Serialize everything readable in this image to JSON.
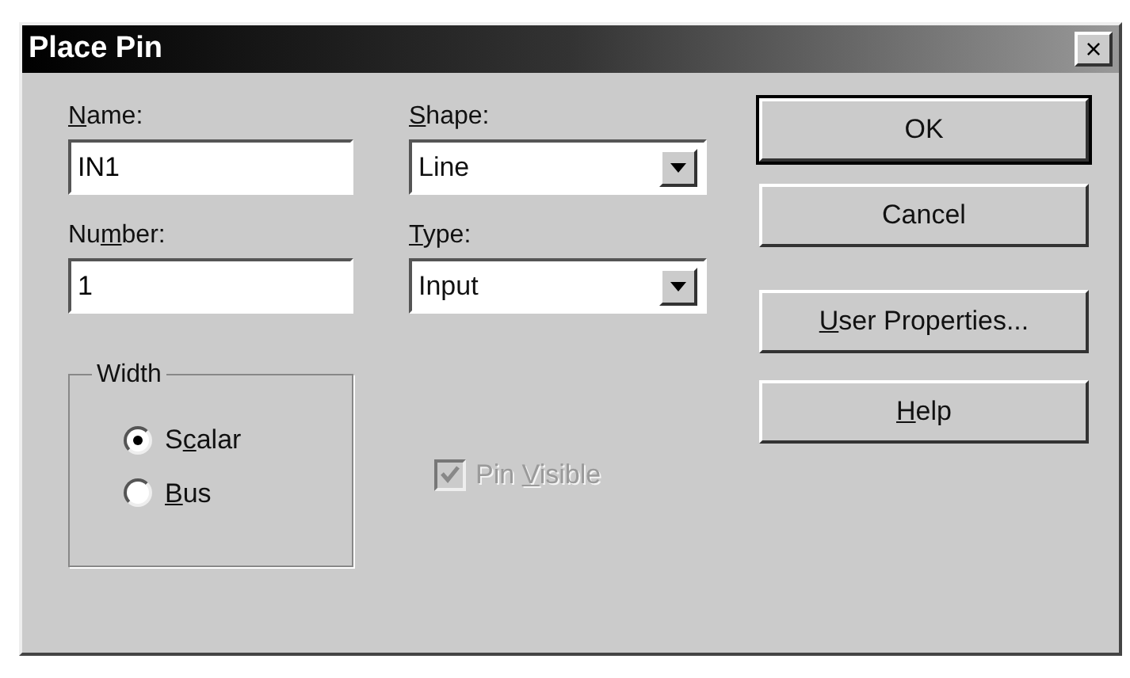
{
  "window": {
    "title": "Place Pin",
    "close": "×"
  },
  "name": {
    "label": {
      "key": "N",
      "post": "ame:"
    },
    "value": "IN1"
  },
  "number": {
    "label": {
      "pre": "Nu",
      "key": "m",
      "post": "ber:"
    },
    "value": "1"
  },
  "shape": {
    "label": {
      "key": "S",
      "post": "hape:"
    },
    "value": "Line"
  },
  "type": {
    "label": {
      "key": "T",
      "post": "ype:"
    },
    "value": "Input"
  },
  "width_group": {
    "title": "Width",
    "options": [
      {
        "label": {
          "pre": "S",
          "key": "c",
          "post": "alar"
        },
        "selected": true
      },
      {
        "label": {
          "key": "B",
          "post": "us"
        },
        "selected": false
      }
    ]
  },
  "pin_visible": {
    "label": {
      "pre": "Pin ",
      "key": "V",
      "post": "isible"
    },
    "checked": true,
    "disabled": true
  },
  "buttons": [
    {
      "label": {
        "pre": "OK"
      },
      "default": true
    },
    {
      "label": {
        "pre": "Cancel"
      },
      "default": false
    },
    {
      "label": {
        "key": "U",
        "post": "ser Properties..."
      },
      "default": false
    },
    {
      "label": {
        "key": "H",
        "post": "elp"
      },
      "default": false
    }
  ]
}
